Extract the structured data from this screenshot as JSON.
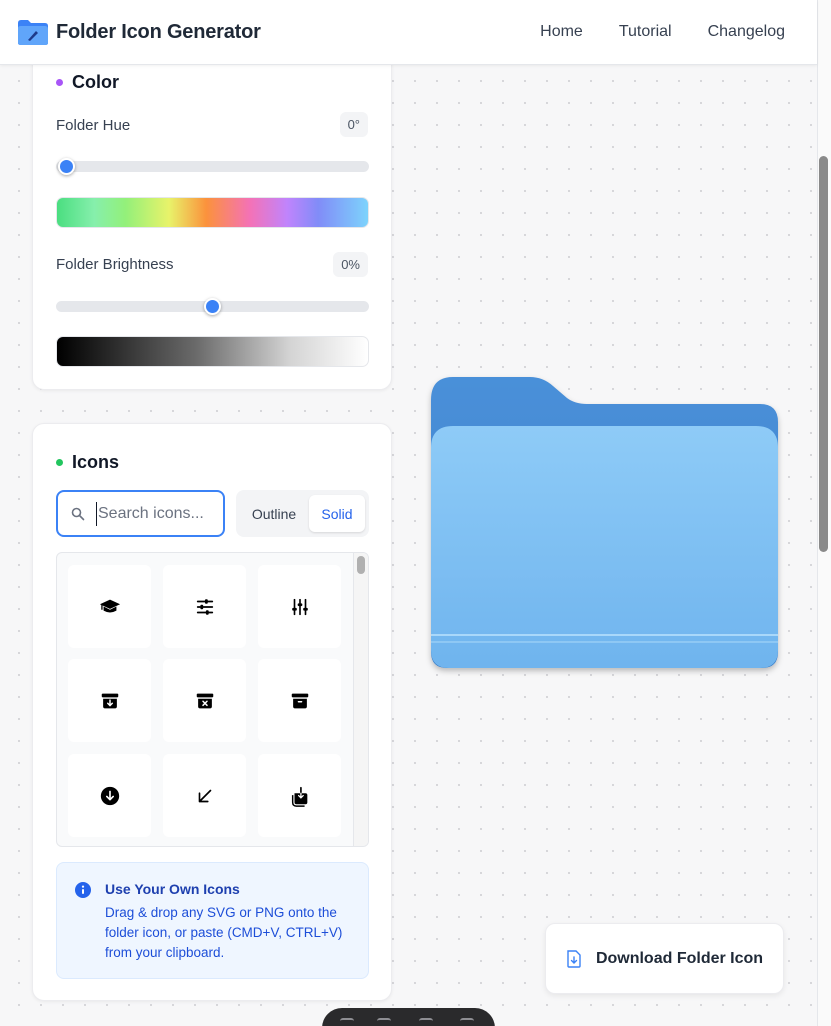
{
  "header": {
    "title": "Folder Icon Generator",
    "nav": [
      "Home",
      "Tutorial",
      "Changelog"
    ]
  },
  "color_section": {
    "title": "Color",
    "dot_color": "#a855f7",
    "hue": {
      "label": "Folder Hue",
      "value": "0°",
      "level": 0.03
    },
    "brightness": {
      "label": "Folder Brightness",
      "value": "0%",
      "level": 0.5
    }
  },
  "icons_section": {
    "title": "Icons",
    "dot_color": "#22c55e",
    "search": {
      "placeholder": "Search icons...",
      "value": ""
    },
    "style_toggle": {
      "options": [
        "Outline",
        "Solid"
      ],
      "selected": "Solid"
    },
    "grid_icons": [
      "academic-cap-icon",
      "adjustments-horizontal-icon",
      "adjustments-vertical-icon",
      "archive-box-arrow-down-icon",
      "archive-box-x-mark-icon",
      "archive-box-icon",
      "arrow-down-circle-icon",
      "arrow-down-left-icon",
      "arrow-down-on-square-icon"
    ],
    "info": {
      "title": "Use Your Own Icons",
      "text": "Drag & drop any SVG or PNG onto the folder icon, or paste (CMD+V, CTRL+V) from your clipboard."
    }
  },
  "preview": {
    "folder_color": "#60a5fa"
  },
  "download": {
    "label": "Download Folder Icon"
  },
  "accent": "#3b82f6"
}
